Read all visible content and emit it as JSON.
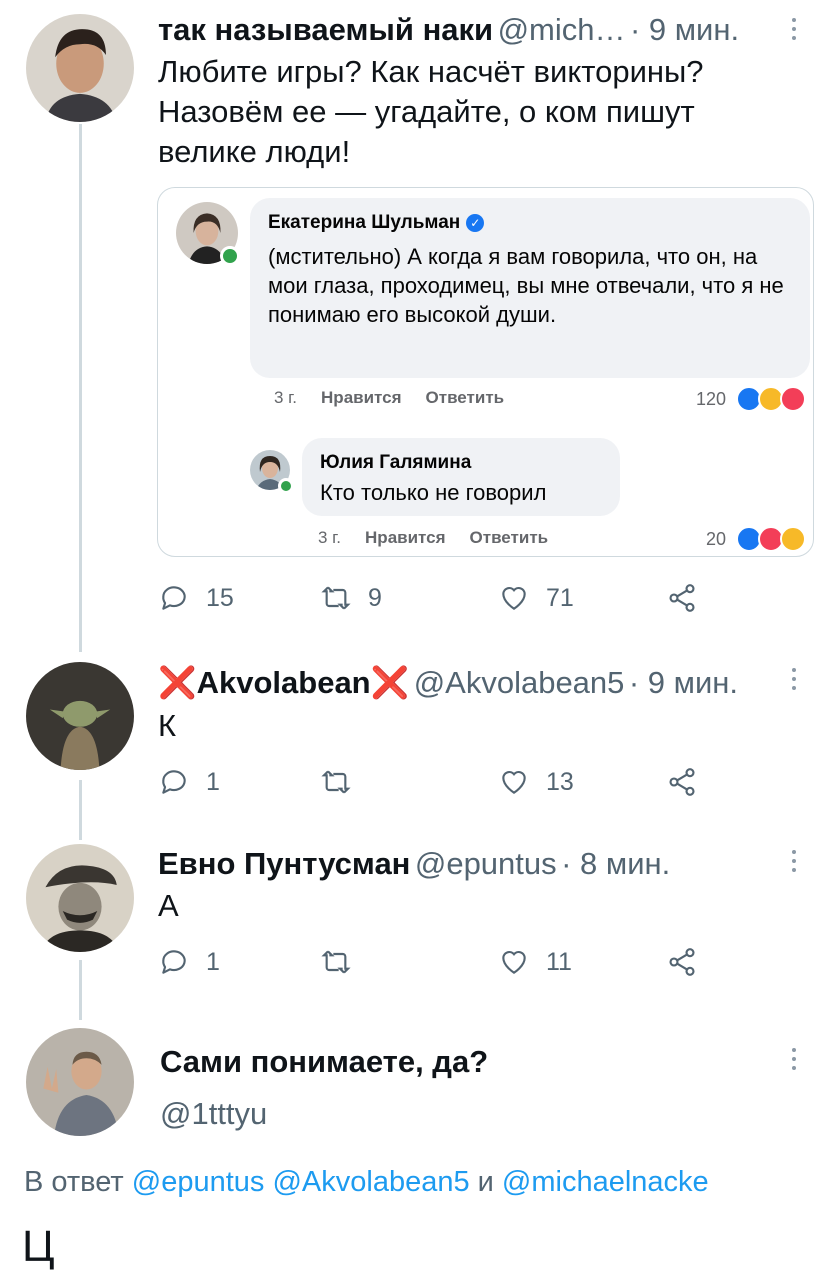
{
  "tweets": [
    {
      "name": "так называемый наки",
      "handle": "@mich…",
      "time": "· 9 мин.",
      "text": "Любите игры? Как насчёт викторины? Назовём ее — угадайте, о ком пишут велике люди!",
      "replies": "15",
      "retweets": "9",
      "likes": "71"
    },
    {
      "name_mark_left": "❌",
      "name": "Akvolabean",
      "name_mark_right": "❌",
      "handle": "@Akvolabean5",
      "time": "· 9 мин.",
      "text": "К",
      "replies": "1",
      "retweets": "",
      "likes": "13"
    },
    {
      "name": "Евно Пунтусман",
      "handle": "@epuntus",
      "time": "· 8 мин.",
      "text": "А",
      "replies": "1",
      "retweets": "",
      "likes": "11"
    },
    {
      "name": "Сами понимаете, да?",
      "handle": "@1tttyu"
    }
  ],
  "embed": {
    "comment1": {
      "name": "Екатерина Шульман",
      "text": "(мстительно) А когда я вам говорила, что он, на мои глаза, проходимец, вы мне отвечали, что я не понимаю его высокой души.",
      "time": "3 г.",
      "like": "Нравится",
      "reply": "Ответить",
      "reactions": "120"
    },
    "comment2": {
      "name": "Юлия Галямина",
      "text": "Кто только не говорил",
      "time": "3 г.",
      "like": "Нравится",
      "reply": "Ответить",
      "reactions": "20"
    }
  },
  "reply_to": {
    "prefix": "В ответ",
    "mentions": [
      "@epuntus",
      "@Akvolabean5"
    ],
    "conj": "и",
    "last": "@michaelnacke"
  },
  "final_text": "Ц",
  "colors": {
    "accent": "#1d9bf0",
    "muted": "#536471",
    "thread_line": "#cfd9de",
    "cross": "#e0245e"
  }
}
